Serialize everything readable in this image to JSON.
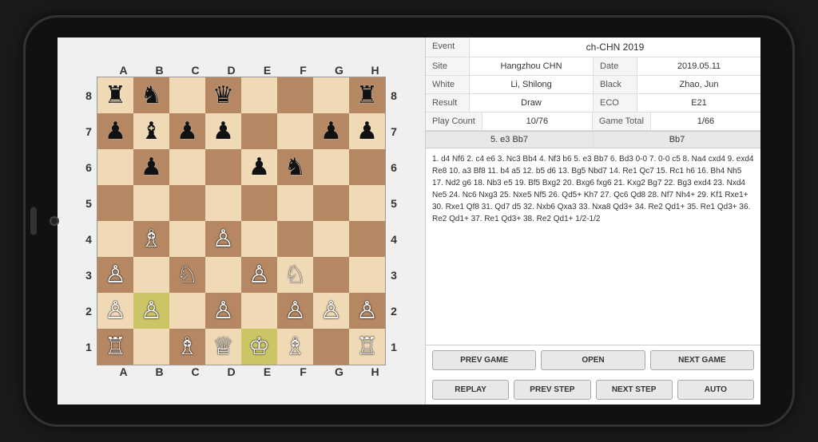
{
  "event": {
    "label": "Event",
    "value": "ch-CHN 2019"
  },
  "site": {
    "label": "Site",
    "value": "Hangzhou CHN"
  },
  "date": {
    "label": "Date",
    "value": "2019.05.11"
  },
  "white": {
    "label": "White",
    "value": "Li, Shilong"
  },
  "black": {
    "label": "Black",
    "value": "Zhao, Jun"
  },
  "result": {
    "label": "Result",
    "value": "Draw"
  },
  "eco": {
    "label": "ECO",
    "value": "E21"
  },
  "playcount": {
    "label": "Play Count",
    "value": "10/76"
  },
  "gametotal": {
    "label": "Game Total",
    "value": "1/66"
  },
  "movehighlight": {
    "move": "5. e3 Bb7",
    "response": "Bb7"
  },
  "movesText": "1. d4 Nf6 2. c4 e6 3. Nc3 Bb4 4. Nf3 b6 5. e3 Bb7 6. Bd3 0-0 7. 0-0 c5 8. Na4 cxd4 9. exd4 Re8 10. a3 Bf8 11. b4 a5 12. b5 d6 13. Bg5 Nbd7 14. Re1 Qc7 15. Rc1 h6 16. Bh4 Nh5 17. Nd2 g6 18. Nb3 e5 19. Bf5 Bxg2 20. Bxg6 fxg6 21. Kxg2 Bg7 22. Bg3 exd4 23. Nxd4 Ne5 24. Nc6 Nxg3 25. Nxe5 Nf5 26. Qd5+ Kh7 27. Qc6 Qd8 28. Nf7 Nh4+ 29. Kf1 Rxe1+ 30. Rxe1 Qf8 31. Qd7 d5 32. Nxb6 Qxa3 33. Nxa8 Qd3+ 34. Re2 Qd1+ 35. Re1 Qd3+ 36. Re2 Qd1+ 37. Re1 Qd3+ 38. Re2 Qd1+ 1/2-1/2",
  "buttons": {
    "prevGame": "PREV GAME",
    "open": "OPEN",
    "nextGame": "NEXT GAME",
    "replay": "REPLAY",
    "prevStep": "PREV STEP",
    "nextStep": "NEXT STEP",
    "auto": "AUTO"
  },
  "colLabels": [
    "A",
    "B",
    "C",
    "D",
    "E",
    "F",
    "G",
    "H"
  ],
  "rowLabels": [
    "8",
    "7",
    "6",
    "5",
    "4",
    "3",
    "2",
    "1"
  ]
}
